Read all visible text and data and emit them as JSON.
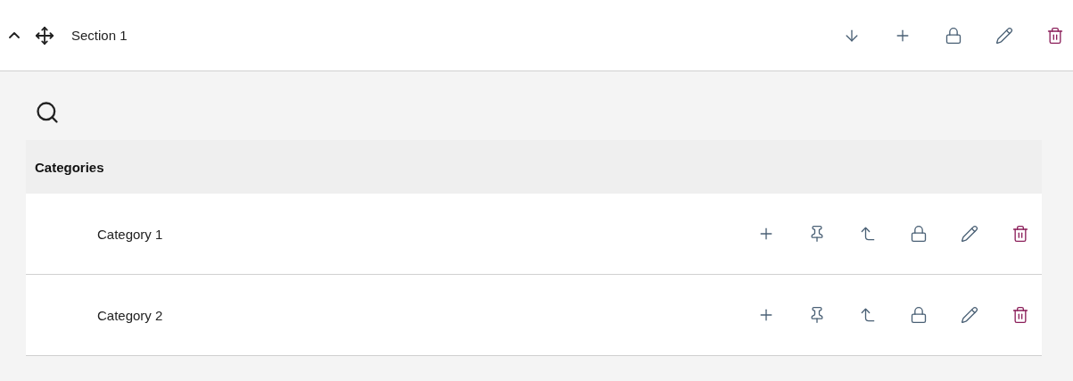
{
  "section": {
    "title": "Section 1",
    "expanded": true
  },
  "table": {
    "heading": "Categories",
    "rows": [
      {
        "name": "Category 1"
      },
      {
        "name": "Category 2"
      }
    ]
  }
}
